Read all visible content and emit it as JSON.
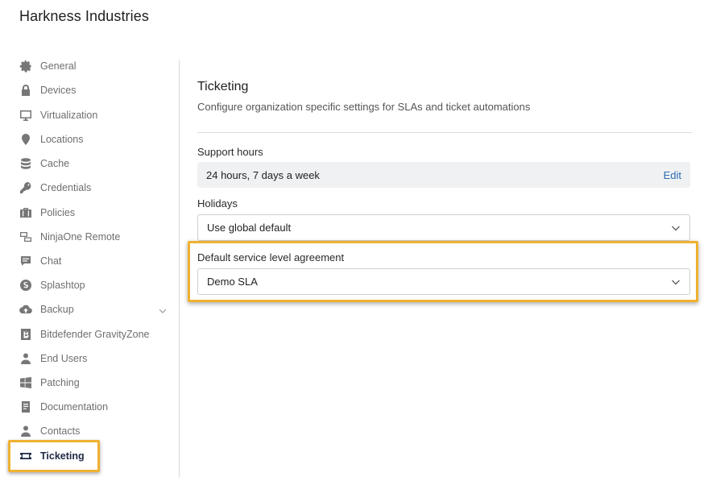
{
  "header": {
    "org_name": "Harkness Industries"
  },
  "sidebar": {
    "items": [
      {
        "label": "General",
        "icon": "gear-icon"
      },
      {
        "label": "Devices",
        "icon": "lock-icon"
      },
      {
        "label": "Virtualization",
        "icon": "monitor-icon"
      },
      {
        "label": "Locations",
        "icon": "map-pin-icon"
      },
      {
        "label": "Cache",
        "icon": "database-icon"
      },
      {
        "label": "Credentials",
        "icon": "key-icon"
      },
      {
        "label": "Policies",
        "icon": "briefcase-icon"
      },
      {
        "label": "NinjaOne Remote",
        "icon": "remote-screens-icon"
      },
      {
        "label": "Chat",
        "icon": "chat-icon"
      },
      {
        "label": "Splashtop",
        "icon": "splashtop-icon"
      },
      {
        "label": "Backup",
        "icon": "cloud-upload-icon"
      },
      {
        "label": "Bitdefender GravityZone",
        "icon": "bitdefender-icon"
      },
      {
        "label": "End Users",
        "icon": "user-icon"
      },
      {
        "label": "Patching",
        "icon": "windows-icon"
      },
      {
        "label": "Documentation",
        "icon": "document-icon"
      },
      {
        "label": "Contacts",
        "icon": "contact-icon"
      },
      {
        "label": "Ticketing",
        "icon": "ticket-icon"
      }
    ]
  },
  "main": {
    "title": "Ticketing",
    "description": "Configure organization specific settings for SLAs and ticket automations",
    "support_hours": {
      "label": "Support hours",
      "value": "24 hours, 7 days a week",
      "edit_label": "Edit"
    },
    "holidays": {
      "label": "Holidays",
      "value": "Use global default"
    },
    "sla": {
      "label": "Default service level agreement",
      "value": "Demo SLA"
    }
  },
  "colors": {
    "highlight": "#f0b132",
    "link": "#2b6cb0",
    "active_nav": "#1f2a44"
  }
}
